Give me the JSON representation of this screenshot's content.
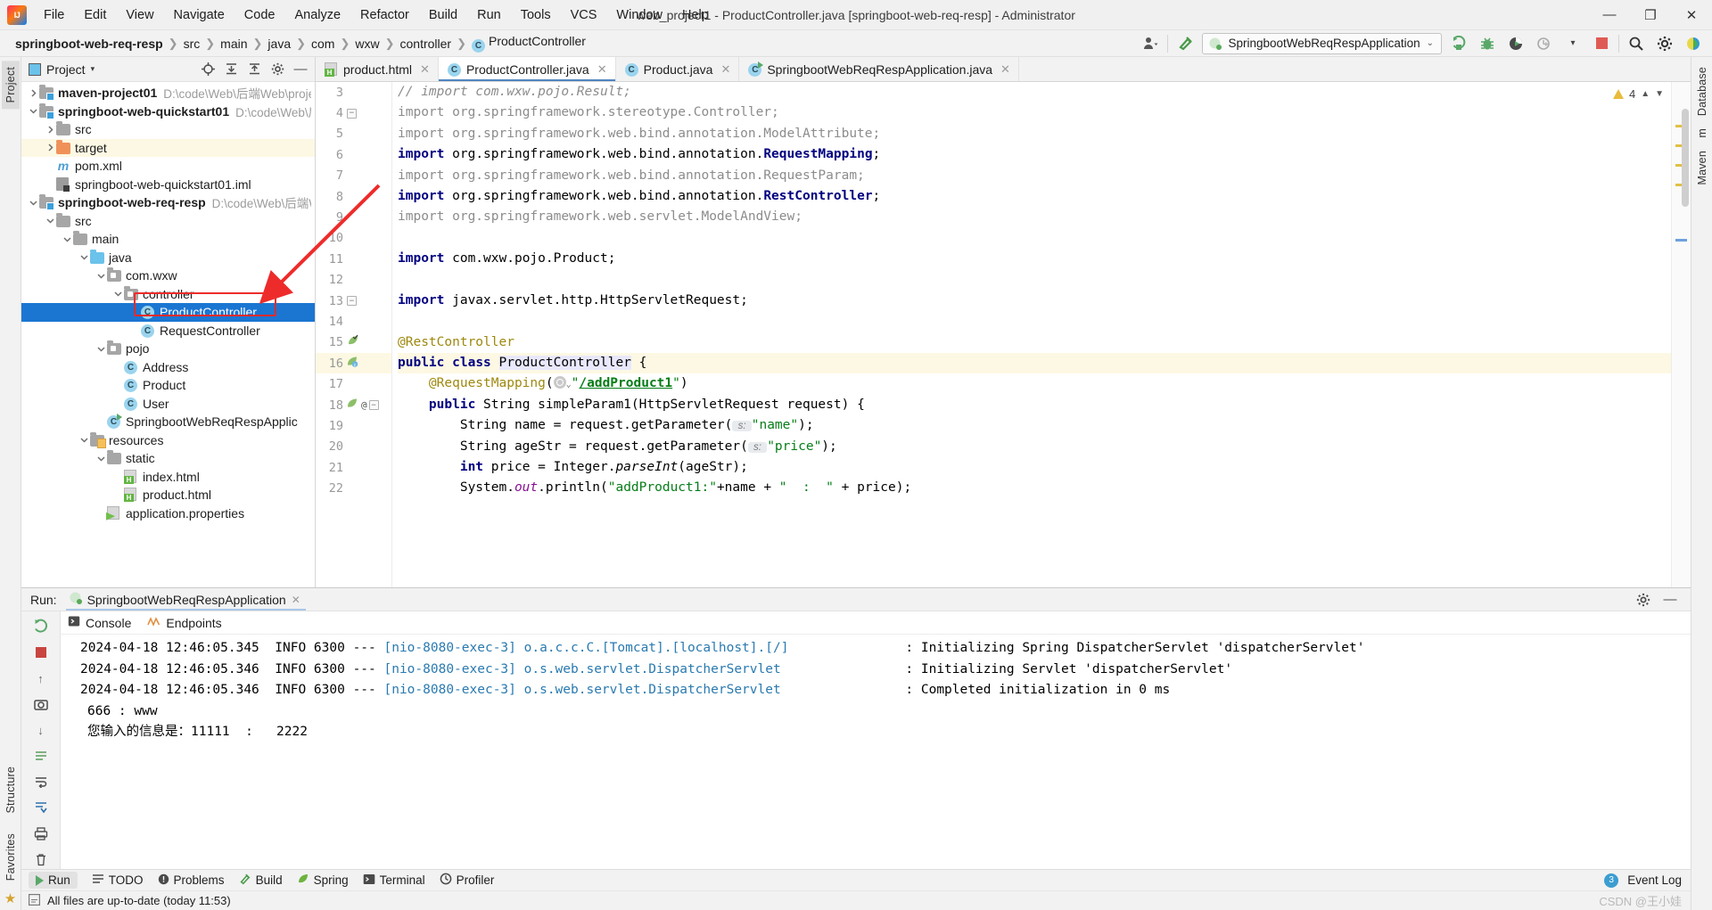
{
  "window": {
    "title": "web_project1 - ProductController.java [springboot-web-req-resp] - Administrator",
    "minimize": "—",
    "maximize": "❐",
    "close": "✕"
  },
  "menubar": {
    "items": [
      "File",
      "Edit",
      "View",
      "Navigate",
      "Code",
      "Analyze",
      "Refactor",
      "Build",
      "Run",
      "Tools",
      "VCS",
      "Window",
      "Help"
    ]
  },
  "breadcrumb": {
    "items": [
      "springboot-web-req-resp",
      "src",
      "main",
      "java",
      "com",
      "wxw",
      "controller",
      "ProductController"
    ],
    "class_icon_letter": "C"
  },
  "toolbar": {
    "run_config": "SpringbootWebReqRespApplication",
    "dropdown_caret": "⌄"
  },
  "left_strip": {
    "tabs": [
      "Project"
    ],
    "bottom_tabs": [
      "Structure",
      "Favorites"
    ]
  },
  "right_strip": {
    "tabs": [
      "Database",
      "m",
      "Maven"
    ]
  },
  "project_panel": {
    "title": "Project",
    "caret": "▾",
    "tree": [
      {
        "depth": 0,
        "arrow": "right",
        "icon": "module-folder",
        "label": "maven-project01",
        "bold": true,
        "path": "D:\\code\\Web\\后端Web\\proje"
      },
      {
        "depth": 0,
        "arrow": "down",
        "icon": "module-folder",
        "label": "springboot-web-quickstart01",
        "bold": true,
        "path": "D:\\code\\Web\\后端"
      },
      {
        "depth": 1,
        "arrow": "right",
        "icon": "folder",
        "label": "src",
        "bold": false,
        "path": ""
      },
      {
        "depth": 1,
        "arrow": "right",
        "icon": "folder-orange",
        "label": "target",
        "bold": false,
        "path": "",
        "highlight": true
      },
      {
        "depth": 1,
        "arrow": "none",
        "icon": "maven",
        "label": "pom.xml",
        "bold": false,
        "path": ""
      },
      {
        "depth": 1,
        "arrow": "none",
        "icon": "iml",
        "label": "springboot-web-quickstart01.iml",
        "bold": false,
        "path": ""
      },
      {
        "depth": 0,
        "arrow": "down",
        "icon": "module-folder",
        "label": "springboot-web-req-resp",
        "bold": true,
        "path": "D:\\code\\Web\\后端We"
      },
      {
        "depth": 1,
        "arrow": "down",
        "icon": "folder",
        "label": "src",
        "bold": false,
        "path": ""
      },
      {
        "depth": 2,
        "arrow": "down",
        "icon": "folder",
        "label": "main",
        "bold": false,
        "path": ""
      },
      {
        "depth": 3,
        "arrow": "down",
        "icon": "folder-blue",
        "label": "java",
        "bold": false,
        "path": ""
      },
      {
        "depth": 4,
        "arrow": "down",
        "icon": "package",
        "label": "com.wxw",
        "bold": false,
        "path": ""
      },
      {
        "depth": 5,
        "arrow": "down",
        "icon": "package",
        "label": "controller",
        "bold": false,
        "path": ""
      },
      {
        "depth": 6,
        "arrow": "none",
        "icon": "class",
        "label": "ProductController",
        "bold": false,
        "path": "",
        "selected": true
      },
      {
        "depth": 6,
        "arrow": "none",
        "icon": "class",
        "label": "RequestController",
        "bold": false,
        "path": ""
      },
      {
        "depth": 4,
        "arrow": "down",
        "icon": "package",
        "label": "pojo",
        "bold": false,
        "path": ""
      },
      {
        "depth": 5,
        "arrow": "none",
        "icon": "class",
        "label": "Address",
        "bold": false,
        "path": ""
      },
      {
        "depth": 5,
        "arrow": "none",
        "icon": "class",
        "label": "Product",
        "bold": false,
        "path": ""
      },
      {
        "depth": 5,
        "arrow": "none",
        "icon": "class",
        "label": "User",
        "bold": false,
        "path": ""
      },
      {
        "depth": 4,
        "arrow": "none",
        "icon": "class-run",
        "label": "SpringbootWebReqRespApplic",
        "bold": false,
        "path": ""
      },
      {
        "depth": 3,
        "arrow": "down",
        "icon": "folder-resources",
        "label": "resources",
        "bold": false,
        "path": ""
      },
      {
        "depth": 4,
        "arrow": "down",
        "icon": "folder",
        "label": "static",
        "bold": false,
        "path": ""
      },
      {
        "depth": 5,
        "arrow": "none",
        "icon": "html",
        "label": "index.html",
        "bold": false,
        "path": ""
      },
      {
        "depth": 5,
        "arrow": "none",
        "icon": "html",
        "label": "product.html",
        "bold": false,
        "path": ""
      },
      {
        "depth": 4,
        "arrow": "none",
        "icon": "properties",
        "label": "application.properties",
        "bold": false,
        "path": ""
      }
    ]
  },
  "editor": {
    "tabs": [
      {
        "label": "product.html",
        "icon": "html",
        "active": false
      },
      {
        "label": "ProductController.java",
        "icon": "class",
        "active": true
      },
      {
        "label": "Product.java",
        "icon": "class",
        "active": false
      },
      {
        "label": "SpringbootWebReqRespApplication.java",
        "icon": "class-run",
        "active": false
      }
    ],
    "warning_count": "4",
    "lines": [
      {
        "no": "3",
        "marks": "",
        "fold": ""
      },
      {
        "no": "4",
        "marks": "",
        "fold": "minus"
      },
      {
        "no": "5",
        "marks": "",
        "fold": ""
      },
      {
        "no": "6",
        "marks": "",
        "fold": ""
      },
      {
        "no": "7",
        "marks": "",
        "fold": ""
      },
      {
        "no": "8",
        "marks": "",
        "fold": ""
      },
      {
        "no": "9",
        "marks": "",
        "fold": ""
      },
      {
        "no": "10",
        "marks": "",
        "fold": ""
      },
      {
        "no": "11",
        "marks": "",
        "fold": ""
      },
      {
        "no": "12",
        "marks": "",
        "fold": ""
      },
      {
        "no": "13",
        "marks": "",
        "fold": "minus"
      },
      {
        "no": "14",
        "marks": "",
        "fold": ""
      },
      {
        "no": "15",
        "marks": "spring-bean",
        "fold": ""
      },
      {
        "no": "16",
        "marks": "spring-bean-nav",
        "fold": "",
        "highlight": true
      },
      {
        "no": "17",
        "marks": "",
        "fold": ""
      },
      {
        "no": "18",
        "marks": "spring-mapping",
        "fold": "minus"
      },
      {
        "no": "19",
        "marks": "",
        "fold": ""
      },
      {
        "no": "20",
        "marks": "",
        "fold": ""
      },
      {
        "no": "21",
        "marks": "",
        "fold": ""
      },
      {
        "no": "22",
        "marks": "",
        "fold": ""
      }
    ],
    "code_text": [
      "// import com.wxw.pojo.Result;",
      "import org.springframework.stereotype.Controller;",
      "import org.springframework.web.bind.annotation.ModelAttribute;",
      "import org.springframework.web.bind.annotation.RequestMapping;",
      "import org.springframework.web.bind.annotation.RequestParam;",
      "import org.springframework.web.bind.annotation.RestController;",
      "import org.springframework.web.servlet.ModelAndView;",
      "",
      "import com.wxw.pojo.Product;",
      "",
      "import javax.servlet.http.HttpServletRequest;",
      "",
      "@RestController",
      "public class ProductController {",
      "    @RequestMapping(\"/addProduct1\")",
      "    public String simpleParam1(HttpServletRequest request) {",
      "        String name = request.getParameter( s: \"name\");",
      "        String ageStr = request.getParameter( s: \"price\");",
      "        int price = Integer.parseInt(ageStr);",
      "        System.out.println(\"addProduct1:\"+name + \"  :  \" + price);"
    ],
    "mapping_path": "/addProduct1",
    "param_hint_1": "s:",
    "param_hint_2": "s:"
  },
  "run_panel": {
    "run_label": "Run:",
    "tab_label": "SpringbootWebReqRespApplication",
    "close": "✕",
    "console_tabs": [
      "Console",
      "Endpoints"
    ],
    "log_lines": [
      {
        "date": "2024-04-18 12:46:05.345",
        "level": "INFO",
        "pid": "6300",
        "dashes": "---",
        "thread": "[nio-8080-exec-3]",
        "logger": "o.a.c.c.C.[Tomcat].[localhost].[/]",
        "sep": ":",
        "message": "Initializing Spring DispatcherServlet 'dispatcherServlet'"
      },
      {
        "date": "2024-04-18 12:46:05.346",
        "level": "INFO",
        "pid": "6300",
        "dashes": "---",
        "thread": "[nio-8080-exec-3]",
        "logger": "o.s.web.servlet.DispatcherServlet",
        "sep": ":",
        "message": "Initializing Servlet 'dispatcherServlet'"
      },
      {
        "date": "2024-04-18 12:46:05.346",
        "level": "INFO",
        "pid": "6300",
        "dashes": "---",
        "thread": "[nio-8080-exec-3]",
        "logger": "o.s.web.servlet.DispatcherServlet",
        "sep": ":",
        "message": "Completed initialization in 0 ms"
      }
    ],
    "plain_lines": [
      "666 : www",
      "您输入的信息是：11111  :   2222"
    ]
  },
  "status_bar": {
    "items": [
      "Run",
      "TODO",
      "Problems",
      "Build",
      "Spring",
      "Terminal",
      "Profiler"
    ],
    "event_log": "Event Log",
    "event_count": "3",
    "message": "All files are up-to-date (today 11:53)",
    "watermark": "CSDN @王小娃"
  }
}
